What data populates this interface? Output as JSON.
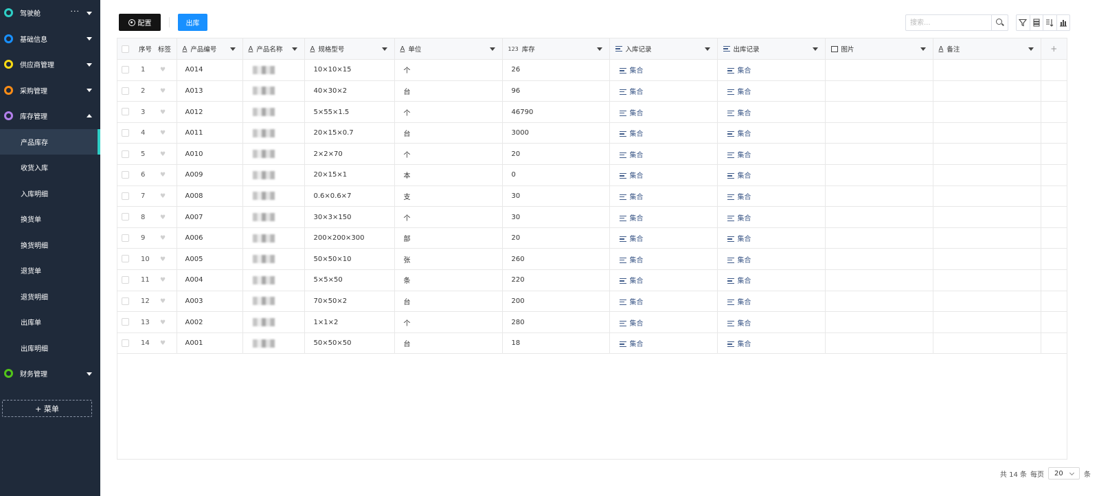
{
  "sidebar": {
    "groups": [
      {
        "label": "驾驶舱",
        "color": "#2ecfc6",
        "more": "···"
      },
      {
        "label": "基础信息",
        "color": "#1890ff"
      },
      {
        "label": "供应商管理",
        "color": "#fadb14"
      },
      {
        "label": "采购管理",
        "color": "#fa8c16"
      },
      {
        "label": "库存管理",
        "color": "#b37feb",
        "expanded": true
      }
    ],
    "subitems": [
      "产品库存",
      "收货入库",
      "入库明细",
      "换货单",
      "换货明细",
      "退货单",
      "退货明细",
      "出库单",
      "出库明细"
    ],
    "active_subitem": "产品库存",
    "finance": {
      "label": "财务管理",
      "color": "#52c41a"
    },
    "add_menu_label": "+ 菜单"
  },
  "toolbar": {
    "config_label": "配置",
    "out_label": "出库",
    "search_placeholder": "搜索..."
  },
  "table": {
    "columns": {
      "seq": "序号",
      "tag": "标签",
      "code": "产品编号",
      "name": "产品名称",
      "spec": "规格型号",
      "unit": "单位",
      "stock": "库存",
      "stock_prefix": "123",
      "in_records": "入库记录",
      "out_records": "出库记录",
      "image": "图片",
      "remark": "备注",
      "text_type_icon": "A",
      "add": "+"
    },
    "collection_label": "集合",
    "rows": [
      {
        "seq": "1",
        "code": "A014",
        "spec": "10×10×15",
        "unit": "个",
        "stock": "26"
      },
      {
        "seq": "2",
        "code": "A013",
        "spec": "40×30×2",
        "unit": "台",
        "stock": "96"
      },
      {
        "seq": "3",
        "code": "A012",
        "spec": "5×55×1.5",
        "unit": "个",
        "stock": "46790"
      },
      {
        "seq": "4",
        "code": "A011",
        "spec": "20×15×0.7",
        "unit": "台",
        "stock": "3000"
      },
      {
        "seq": "5",
        "code": "A010",
        "spec": "2×2×70",
        "unit": "个",
        "stock": "20"
      },
      {
        "seq": "6",
        "code": "A009",
        "spec": "20×15×1",
        "unit": "本",
        "stock": "0"
      },
      {
        "seq": "7",
        "code": "A008",
        "spec": "0.6×0.6×7",
        "unit": "支",
        "stock": "30"
      },
      {
        "seq": "8",
        "code": "A007",
        "spec": "30×3×150",
        "unit": "个",
        "stock": "30"
      },
      {
        "seq": "9",
        "code": "A006",
        "spec": "200×200×300",
        "unit": "部",
        "stock": "20"
      },
      {
        "seq": "10",
        "code": "A005",
        "spec": "50×50×10",
        "unit": "张",
        "stock": "260"
      },
      {
        "seq": "11",
        "code": "A004",
        "spec": "5×5×50",
        "unit": "条",
        "stock": "220"
      },
      {
        "seq": "12",
        "code": "A003",
        "spec": "70×50×2",
        "unit": "台",
        "stock": "200"
      },
      {
        "seq": "13",
        "code": "A002",
        "spec": "1×1×2",
        "unit": "个",
        "stock": "280"
      },
      {
        "seq": "14",
        "code": "A001",
        "spec": "50×50×50",
        "unit": "台",
        "stock": "18"
      }
    ]
  },
  "footer": {
    "total_text": "共 14 条",
    "per_page_label": "每页",
    "page_size": "20",
    "unit_label": "条"
  }
}
